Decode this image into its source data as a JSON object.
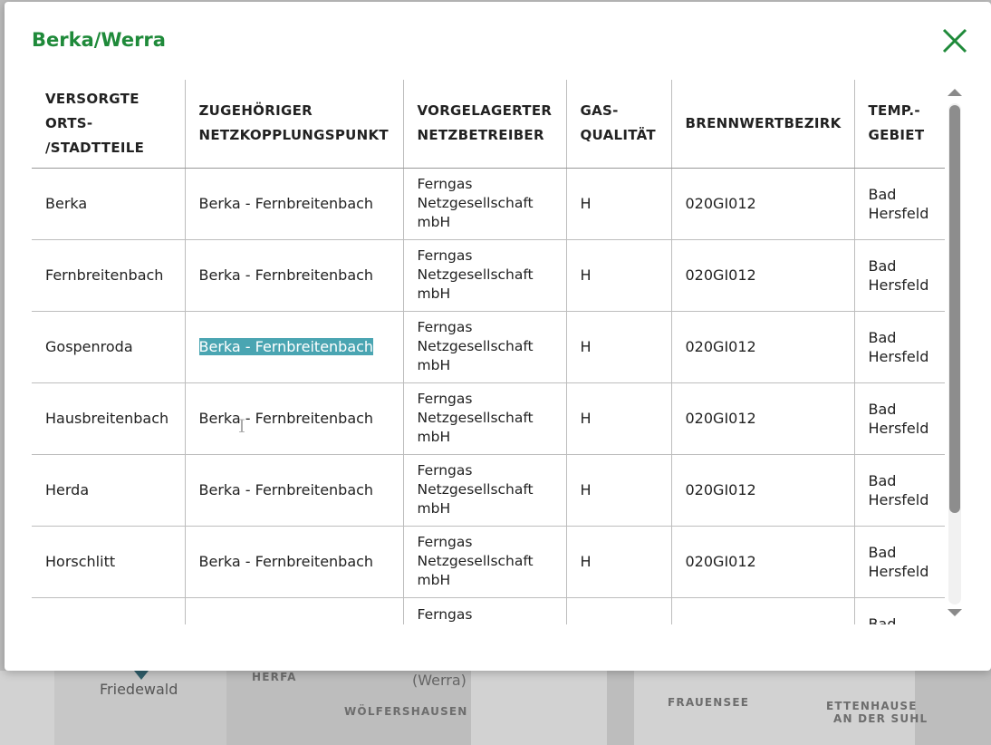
{
  "map": {
    "labels": [
      "HERFA",
      "WÖLFERSHAUSEN",
      "FRAUENSEE",
      "ETTENHAUSE",
      "AN DER SUHL"
    ],
    "city": "Friedewald",
    "river": "(Werra)"
  },
  "modal": {
    "title": "Berka/Werra",
    "close_icon": "close-icon"
  },
  "table": {
    "headers": [
      "VERSORGTE ORTS- /STADTTEILE",
      "ZUGEHÖRIGER NETZKOPPLUNGSPUNKT",
      "VORGELAGERTER NETZBETREIBER",
      "GAS- QUALITÄT",
      "BRENNWERTBEZIRK",
      "TEMP.- GEBIET"
    ],
    "rows": [
      [
        "Berka",
        "Berka - Fernbreitenbach",
        "Ferngas Netzgesellschaft mbH",
        "H",
        "020GI012",
        "Bad Hersfeld"
      ],
      [
        "Fernbreitenbach",
        "Berka - Fernbreitenbach",
        "Ferngas Netzgesellschaft mbH",
        "H",
        "020GI012",
        "Bad Hersfeld"
      ],
      [
        "Gospenroda",
        "Berka - Fernbreitenbach",
        "Ferngas Netzgesellschaft mbH",
        "H",
        "020GI012",
        "Bad Hersfeld"
      ],
      [
        "Hausbreitenbach",
        "Berka - Fernbreitenbach",
        "Ferngas Netzgesellschaft mbH",
        "H",
        "020GI012",
        "Bad Hersfeld"
      ],
      [
        "Herda",
        "Berka - Fernbreitenbach",
        "Ferngas Netzgesellschaft mbH",
        "H",
        "020GI012",
        "Bad Hersfeld"
      ],
      [
        "Horschlitt",
        "Berka - Fernbreitenbach",
        "Ferngas Netzgesellschaft mbH",
        "H",
        "020GI012",
        "Bad Hersfeld"
      ],
      [
        "",
        "",
        "Ferngas",
        "",
        "",
        "Bad"
      ]
    ],
    "selected": {
      "row": 2,
      "col": 1
    }
  },
  "colors": {
    "title": "#1f8a3a",
    "close": "#1f8a3a",
    "selection": "#4aa5b2"
  }
}
